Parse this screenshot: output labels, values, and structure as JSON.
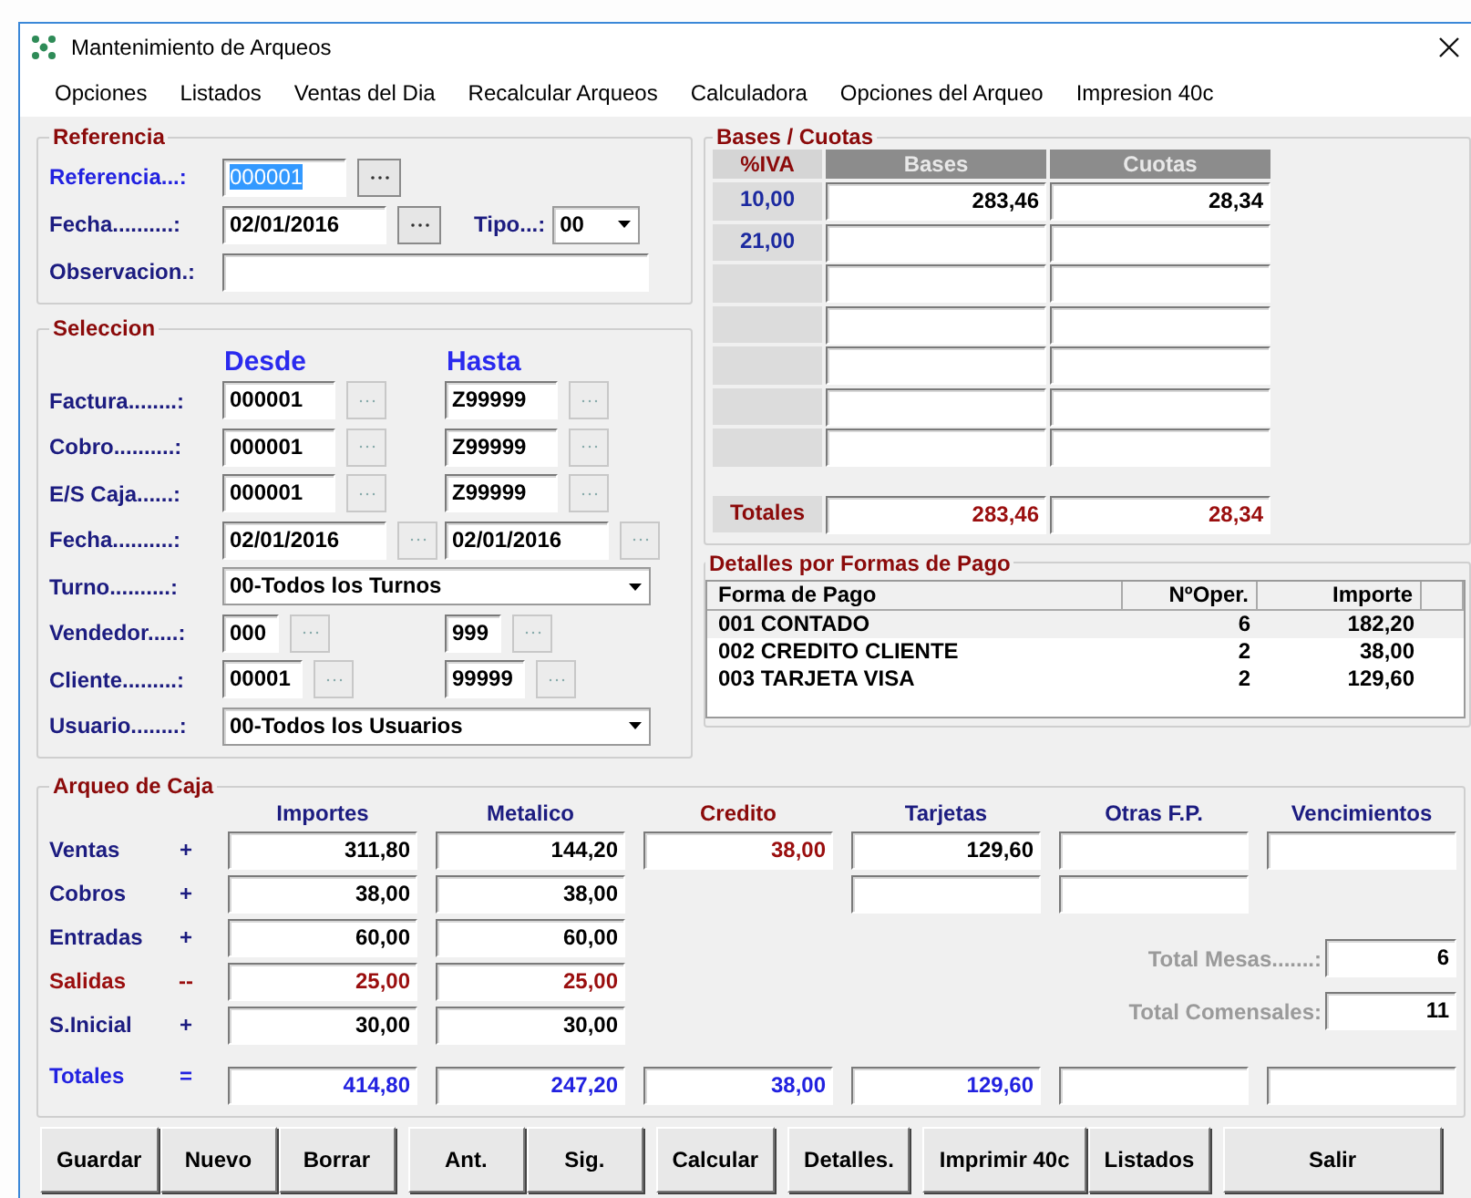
{
  "window": {
    "title": "Mantenimiento de Arqueos"
  },
  "menu": [
    "Opciones",
    "Listados",
    "Ventas del Dia",
    "Recalcular Arqueos",
    "Calculadora",
    "Opciones del Arqueo",
    "Impresion 40c"
  ],
  "referencia": {
    "legend": "Referencia",
    "referencia": {
      "label": "Referencia...:",
      "value": "000001",
      "selected": true
    },
    "fecha": {
      "label": "Fecha..........:",
      "value": "02/01/2016"
    },
    "tipo": {
      "label": "Tipo...:",
      "value": "00"
    },
    "observacion": {
      "label": "Observacion.:"
    }
  },
  "seleccion": {
    "legend": "Seleccion",
    "desde": "Desde",
    "hasta": "Hasta",
    "rows": [
      {
        "kind": "range",
        "label": "Factura........:",
        "from": "000001",
        "to": "Z99999"
      },
      {
        "kind": "range",
        "label": "Cobro..........:",
        "from": "000001",
        "to": "Z99999"
      },
      {
        "kind": "range",
        "label": "E/S Caja......:",
        "from": "000001",
        "to": "Z99999"
      },
      {
        "kind": "date",
        "label": "Fecha..........:",
        "from": "02/01/2016",
        "to": "02/01/2016"
      },
      {
        "kind": "select",
        "label": "Turno..........:",
        "value": "00-Todos los Turnos"
      },
      {
        "kind": "short",
        "label": "Vendedor.....:",
        "from": "000",
        "to": "999"
      },
      {
        "kind": "short",
        "label": "Cliente.........:",
        "from": "00001",
        "to": "99999"
      },
      {
        "kind": "select",
        "label": "Usuario........:",
        "value": "00-Todos los Usuarios"
      }
    ]
  },
  "bases": {
    "legend": "Bases / Cuotas",
    "iva_header": "%IVA",
    "columns": [
      "Bases",
      "Cuotas"
    ],
    "rows": [
      {
        "iva": "10,00",
        "base": "283,46",
        "cuota": "28,34"
      },
      {
        "iva": "21,00"
      },
      {},
      {},
      {},
      {},
      {}
    ],
    "totals": {
      "label": "Totales",
      "base": "283,46",
      "cuota": "28,34"
    }
  },
  "detalles": {
    "legend": "Detalles por Formas de Pago",
    "columns": [
      "Forma de Pago",
      "NºOper.",
      "Importe"
    ],
    "rows": [
      {
        "forma": "001 CONTADO",
        "oper": "6",
        "importe": "182,20",
        "selected": true
      },
      {
        "forma": "002 CREDITO CLIENTE",
        "oper": "2",
        "importe": "38,00",
        "selected": false
      },
      {
        "forma": "003 TARJETA VISA",
        "oper": "2",
        "importe": "129,60",
        "selected": false
      }
    ]
  },
  "arqueo": {
    "legend": "Arqueo de Caja",
    "columns": [
      {
        "label": "Importes",
        "kind": "normal"
      },
      {
        "label": "Metalico",
        "kind": "normal"
      },
      {
        "label": "Credito",
        "kind": "credit"
      },
      {
        "label": "Tarjetas",
        "kind": "normal"
      },
      {
        "label": "Otras F.P.",
        "kind": "normal"
      },
      {
        "label": "Vencimientos",
        "kind": "normal"
      }
    ],
    "rows": [
      {
        "label": "Ventas",
        "sign": "+",
        "kind": "plus",
        "cells": [
          {
            "value": "311,80"
          },
          {
            "value": "144,20"
          },
          {
            "value": "38,00"
          },
          {
            "value": "129,60"
          },
          {
            "blank": true
          },
          {
            "blank": true
          }
        ]
      },
      {
        "label": "Cobros",
        "sign": "+",
        "kind": "plus",
        "cells": [
          {
            "value": "38,00"
          },
          {
            "value": "38,00"
          },
          null,
          {
            "blank": true
          },
          {
            "blank": true
          },
          null
        ]
      },
      {
        "label": "Entradas",
        "sign": "+",
        "kind": "plus",
        "cells": [
          {
            "value": "60,00"
          },
          {
            "value": "60,00"
          },
          null,
          null,
          null,
          null
        ]
      },
      {
        "label": "Salidas",
        "sign": "--",
        "kind": "minus",
        "cells": [
          {
            "value": "25,00"
          },
          {
            "value": "25,00"
          },
          null,
          null,
          null,
          null
        ]
      },
      {
        "label": "S.Inicial",
        "sign": "+",
        "kind": "plus",
        "cells": [
          {
            "value": "30,00"
          },
          {
            "value": "30,00"
          },
          null,
          null,
          null,
          null
        ]
      },
      {
        "label": "Totales",
        "sign": "=",
        "kind": "total",
        "cells": [
          {
            "value": "414,80"
          },
          {
            "value": "247,20"
          },
          {
            "value": "38,00"
          },
          {
            "value": "129,60"
          },
          {
            "blank": true
          },
          {
            "blank": true
          }
        ]
      }
    ],
    "summary": [
      {
        "label": "Total Mesas.......:",
        "value": "6"
      },
      {
        "label": "Total Comensales:",
        "value": "11"
      }
    ]
  },
  "button_groups": [
    [
      "Guardar",
      "Nuevo",
      "Borrar"
    ],
    [
      "Ant.",
      "Sig."
    ],
    [
      "Calcular"
    ],
    [
      "Detalles."
    ],
    [
      "Imprimir 40c",
      "Listados"
    ],
    [
      "Salir"
    ]
  ]
}
